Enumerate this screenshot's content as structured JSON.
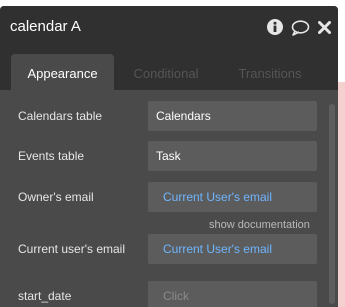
{
  "window": {
    "title": "calendar A",
    "icons": [
      "info-icon",
      "comment-icon",
      "close-icon"
    ]
  },
  "tabs": [
    {
      "label": "Appearance",
      "active": true
    },
    {
      "label": "Conditional",
      "active": false
    },
    {
      "label": "Transitions",
      "active": false
    }
  ],
  "properties": [
    {
      "label": "Calendars table",
      "value": "Calendars",
      "kind": "static"
    },
    {
      "label": "Events table",
      "value": "Task",
      "kind": "static"
    },
    {
      "label": "Owner's email",
      "value": "Current User's email",
      "kind": "dynamic"
    },
    {
      "label": "Current user's email",
      "value": "Current User's email",
      "kind": "dynamic"
    },
    {
      "label": "start_date",
      "value": "Click",
      "kind": "placeholder"
    }
  ],
  "doc_link": "show documentation",
  "colors": {
    "panel_bg": "#4a4a4a",
    "header_bg": "#303030",
    "field_bg": "#5c5c5c",
    "dynamic_text": "#6fb5ff",
    "background_accent": "#f4d1ce"
  }
}
